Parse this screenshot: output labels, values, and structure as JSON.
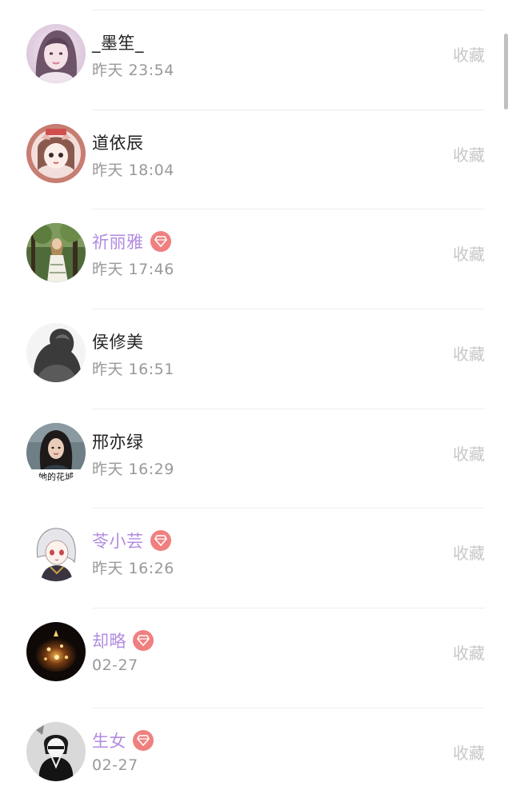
{
  "collect_label": "收藏",
  "users": [
    {
      "name": "_墨笙_",
      "time": "昨天 23:54",
      "vip": false,
      "avatar_icon": "girl-portrait-avatar"
    },
    {
      "name": "道依辰",
      "time": "昨天 18:04",
      "vip": false,
      "avatar_icon": "cartoon-girl-avatar"
    },
    {
      "name": "祈丽雅",
      "time": "昨天 17:46",
      "vip": true,
      "avatar_icon": "woman-in-forest-avatar"
    },
    {
      "name": "侯修美",
      "time": "昨天 16:51",
      "vip": false,
      "avatar_icon": "grayscale-silhouette-avatar"
    },
    {
      "name": "邢亦绿",
      "time": "昨天 16:29",
      "vip": false,
      "avatar_icon": "long-hair-woman-avatar",
      "avatar_caption": "她的花城"
    },
    {
      "name": "苓小芸",
      "time": "昨天 16:26",
      "vip": true,
      "avatar_icon": "anime-character-avatar"
    },
    {
      "name": "却略",
      "time": "02-27",
      "vip": true,
      "avatar_icon": "candle-lantern-avatar"
    },
    {
      "name": "生女",
      "time": "02-27",
      "vip": true,
      "avatar_icon": "masked-figure-avatar"
    }
  ],
  "colors": {
    "vip_name": "#b28ce0",
    "vip_badge": "#f08080",
    "normal_name": "#222222",
    "time": "#999999",
    "collect": "#c7c7c7"
  },
  "vip_badge_icon": "diamond-icon"
}
